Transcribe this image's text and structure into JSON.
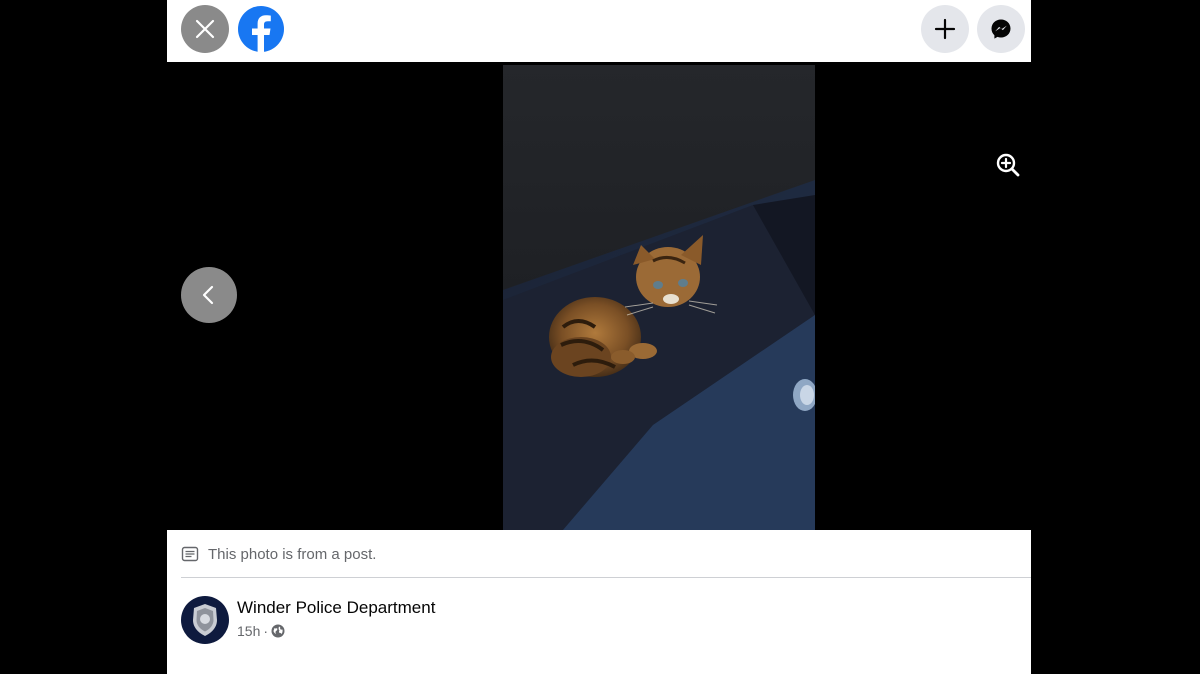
{
  "header": {
    "close_icon": "close-icon",
    "logo_icon": "facebook-logo-icon",
    "create_icon": "plus-icon",
    "messenger_icon": "messenger-icon",
    "brand_color": "#1877f2"
  },
  "viewer": {
    "zoom_icon": "zoom-in-icon",
    "prev_icon": "chevron-left-icon",
    "photo_subject": "kitten"
  },
  "post": {
    "notice_icon": "post-icon",
    "notice_text": "This photo is from a post.",
    "author": "Winder Police Department",
    "time": "15h",
    "separator": "·",
    "audience_icon": "globe-icon"
  }
}
